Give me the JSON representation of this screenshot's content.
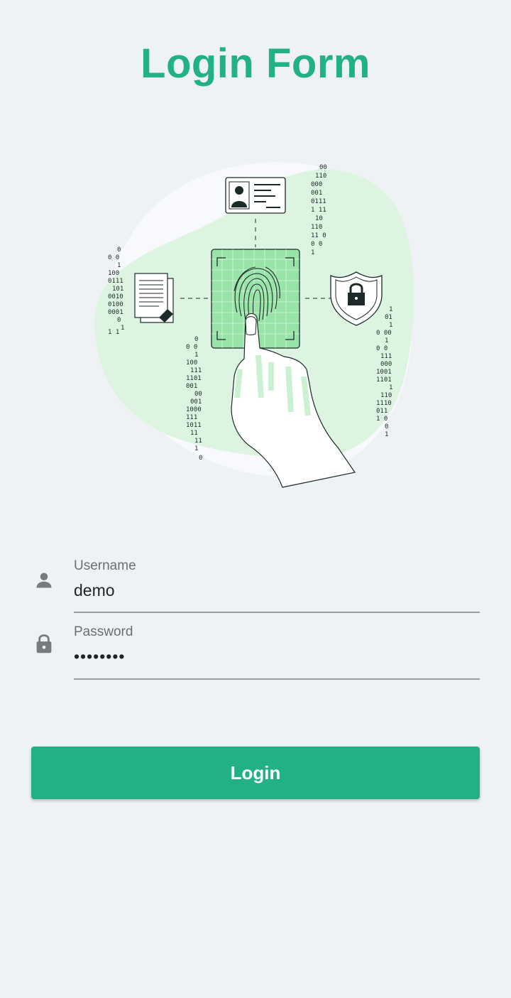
{
  "page": {
    "title": "Login Form"
  },
  "form": {
    "username": {
      "label": "Username",
      "value": "demo",
      "icon": "person-icon"
    },
    "password": {
      "label": "Password",
      "value": "••••••••",
      "icon": "lock-icon"
    },
    "login_label": "Login"
  },
  "colors": {
    "accent": "#22b085",
    "background": "#eff2f5",
    "illustration_green": "#98e3a8",
    "illustration_blob": "#dcf4e0"
  },
  "illustration": {
    "icon": "fingerprint-scan-illustration"
  }
}
